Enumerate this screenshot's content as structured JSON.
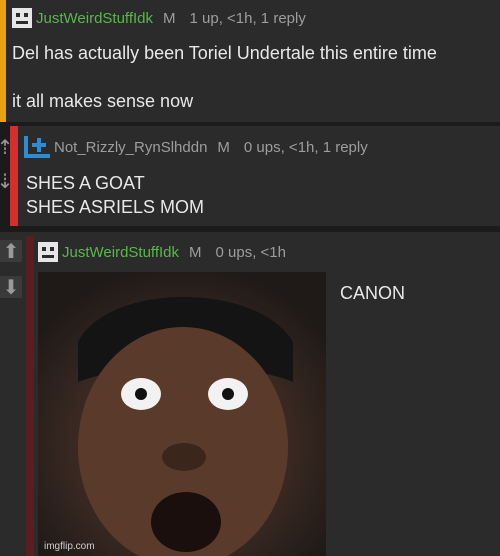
{
  "comments": [
    {
      "username": "JustWeirdStuffIdk",
      "badge": "M",
      "meta": "1 up, <1h, 1 reply",
      "lines": [
        "Del has actually been Toriel Undertale this entire time",
        "it all makes sense now"
      ]
    },
    {
      "username": "Not_Rizzly_RynSlhddn",
      "badge": "M",
      "meta": "0 ups, <1h, 1 reply",
      "lines": [
        "SHES A GOAT",
        "SHES ASRIELS MOM"
      ]
    },
    {
      "username": "JustWeirdStuffIdk",
      "badge": "M",
      "meta": "0 ups, <1h",
      "lines": [
        "CANON"
      ],
      "image_watermark": "imgflip.com"
    }
  ],
  "icons": {
    "upvote": "arrow-up-icon",
    "downvote": "arrow-down-icon",
    "avatar_face": "face-icon",
    "avatar_plus": "plus-icon"
  },
  "colors": {
    "username": "#58b84a",
    "orange_bar": "#e8a10f",
    "red_bar": "#d42e2e",
    "blue_plus": "#2c8cd6"
  }
}
